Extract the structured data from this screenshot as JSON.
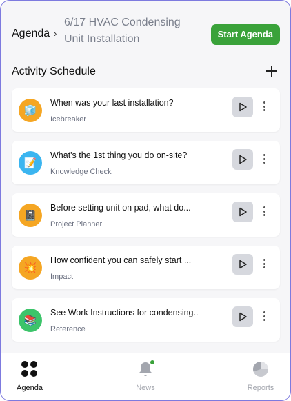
{
  "header": {
    "breadcrumb_root": "Agenda",
    "breadcrumb_separator": "›",
    "title": "6/17 HVAC Condensing Unit Installation",
    "start_button": "Start Agenda"
  },
  "section": {
    "title": "Activity Schedule",
    "add_icon": "plus-icon"
  },
  "activities": [
    {
      "title": "When was your last installation?",
      "type": "Icebreaker",
      "icon": "🧊",
      "icon_bg": "#f5a623",
      "icon_name": "icebreaker-icon"
    },
    {
      "title": "What's the 1st thing you do on-site?",
      "type": "Knowledge Check",
      "icon": "📝",
      "icon_bg": "#3bb5f0",
      "icon_name": "knowledge-check-icon"
    },
    {
      "title": "Before setting unit on pad, what do...",
      "type": "Project Planner",
      "icon": "📓",
      "icon_bg": "#f5a623",
      "icon_name": "project-planner-icon"
    },
    {
      "title": "How confident you can safely start ...",
      "type": "Impact",
      "icon": "💥",
      "icon_bg": "#f5a623",
      "icon_name": "impact-icon"
    },
    {
      "title": "See Work Instructions for condensing..",
      "type": "Reference",
      "icon": "📚",
      "icon_bg": "#3cc46a",
      "icon_name": "reference-icon"
    }
  ],
  "nav": {
    "agenda": "Agenda",
    "news": "News",
    "reports": "Reports"
  },
  "colors": {
    "accent_green": "#3aa23a",
    "frame_border": "#7d7adf",
    "card_bg": "#ffffff",
    "page_bg": "#f6f6f8"
  }
}
